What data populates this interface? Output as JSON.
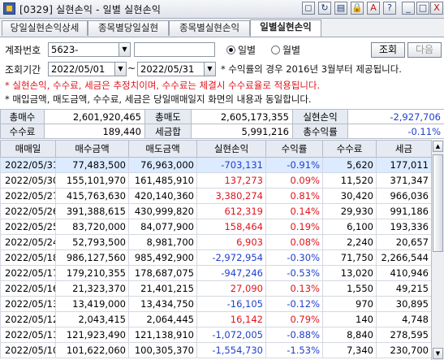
{
  "window": {
    "title": "[0329] 실현손익 - 일별 실현손익",
    "buttons": [
      "◻",
      "↻",
      "▤",
      "🔒",
      "A",
      "?",
      "_",
      "□",
      "X"
    ]
  },
  "tabs": [
    "당일실현손익상세",
    "종목별당일실현",
    "종목별실현손익",
    "일별실현손익"
  ],
  "account": {
    "label": "계좌번호",
    "value": "5623-",
    "password": ""
  },
  "period": {
    "label": "조회기간",
    "start": "2022/05/01",
    "sep": "~",
    "end": "2022/05/31"
  },
  "options": {
    "daily": "일별",
    "monthly": "월별"
  },
  "notes": {
    "rate": "* 수익률의 경우 2016년 3월부터 제공됩니다.",
    "warning": "* 실현손익, 수수료, 세금은 추정치이며, 수수료는 체결시 수수료율로 적용됩니다.",
    "info": "* 매입금액, 매도금액, 수수료, 세금은 당일매매일지 화면의 내용과 동일합니다."
  },
  "actions": {
    "query": "조회",
    "next": "다음"
  },
  "summary": {
    "buy_label": "총매수",
    "buy": "2,601,920,465",
    "sell_label": "총매도",
    "sell": "2,605,173,355",
    "pnl_label": "실현손익",
    "pnl": "-2,927,706",
    "fee_label": "수수료",
    "fee": "189,440",
    "tax_label": "세금합",
    "tax": "5,991,216",
    "rate_label": "총수익률",
    "rate": "-0.11%"
  },
  "grid": {
    "columns": [
      "매매일",
      "매수금액",
      "매도금액",
      "실현손익",
      "수익률",
      "수수료",
      "세금"
    ],
    "rows": [
      [
        "2022/05/31",
        "77,483,500",
        "76,963,000",
        "-703,131",
        "-0.91%",
        "5,620",
        "177,011"
      ],
      [
        "2022/05/30",
        "155,101,970",
        "161,485,910",
        "137,273",
        "0.09%",
        "11,520",
        "371,347"
      ],
      [
        "2022/05/27",
        "415,763,630",
        "420,140,360",
        "3,380,274",
        "0.81%",
        "30,420",
        "966,036"
      ],
      [
        "2022/05/26",
        "391,388,615",
        "430,999,820",
        "612,319",
        "0.14%",
        "29,930",
        "991,186"
      ],
      [
        "2022/05/25",
        "83,720,000",
        "84,077,900",
        "158,464",
        "0.19%",
        "6,100",
        "193,336"
      ],
      [
        "2022/05/24",
        "52,793,500",
        "8,981,700",
        "6,903",
        "0.08%",
        "2,240",
        "20,657"
      ],
      [
        "2022/05/18",
        "986,127,560",
        "985,492,900",
        "-2,972,954",
        "-0.30%",
        "71,750",
        "2,266,544"
      ],
      [
        "2022/05/17",
        "179,210,355",
        "178,687,075",
        "-947,246",
        "-0.53%",
        "13,020",
        "410,946"
      ],
      [
        "2022/05/16",
        "21,323,370",
        "21,401,215",
        "27,090",
        "0.13%",
        "1,550",
        "49,215"
      ],
      [
        "2022/05/13",
        "13,419,000",
        "13,434,750",
        "-16,105",
        "-0.12%",
        "970",
        "30,895"
      ],
      [
        "2022/05/12",
        "2,043,415",
        "2,064,445",
        "16,142",
        "0.79%",
        "140",
        "4,748"
      ],
      [
        "2022/05/11",
        "121,923,490",
        "121,138,910",
        "-1,072,005",
        "-0.88%",
        "8,840",
        "278,595"
      ],
      [
        "2022/05/10",
        "101,622,060",
        "100,305,370",
        "-1,554,730",
        "-1.53%",
        "7,340",
        "230,700"
      ]
    ]
  },
  "colors": {
    "positive": "#e0141e",
    "negative": "#1f3fcf",
    "header_bg": "#e6eaf2"
  }
}
